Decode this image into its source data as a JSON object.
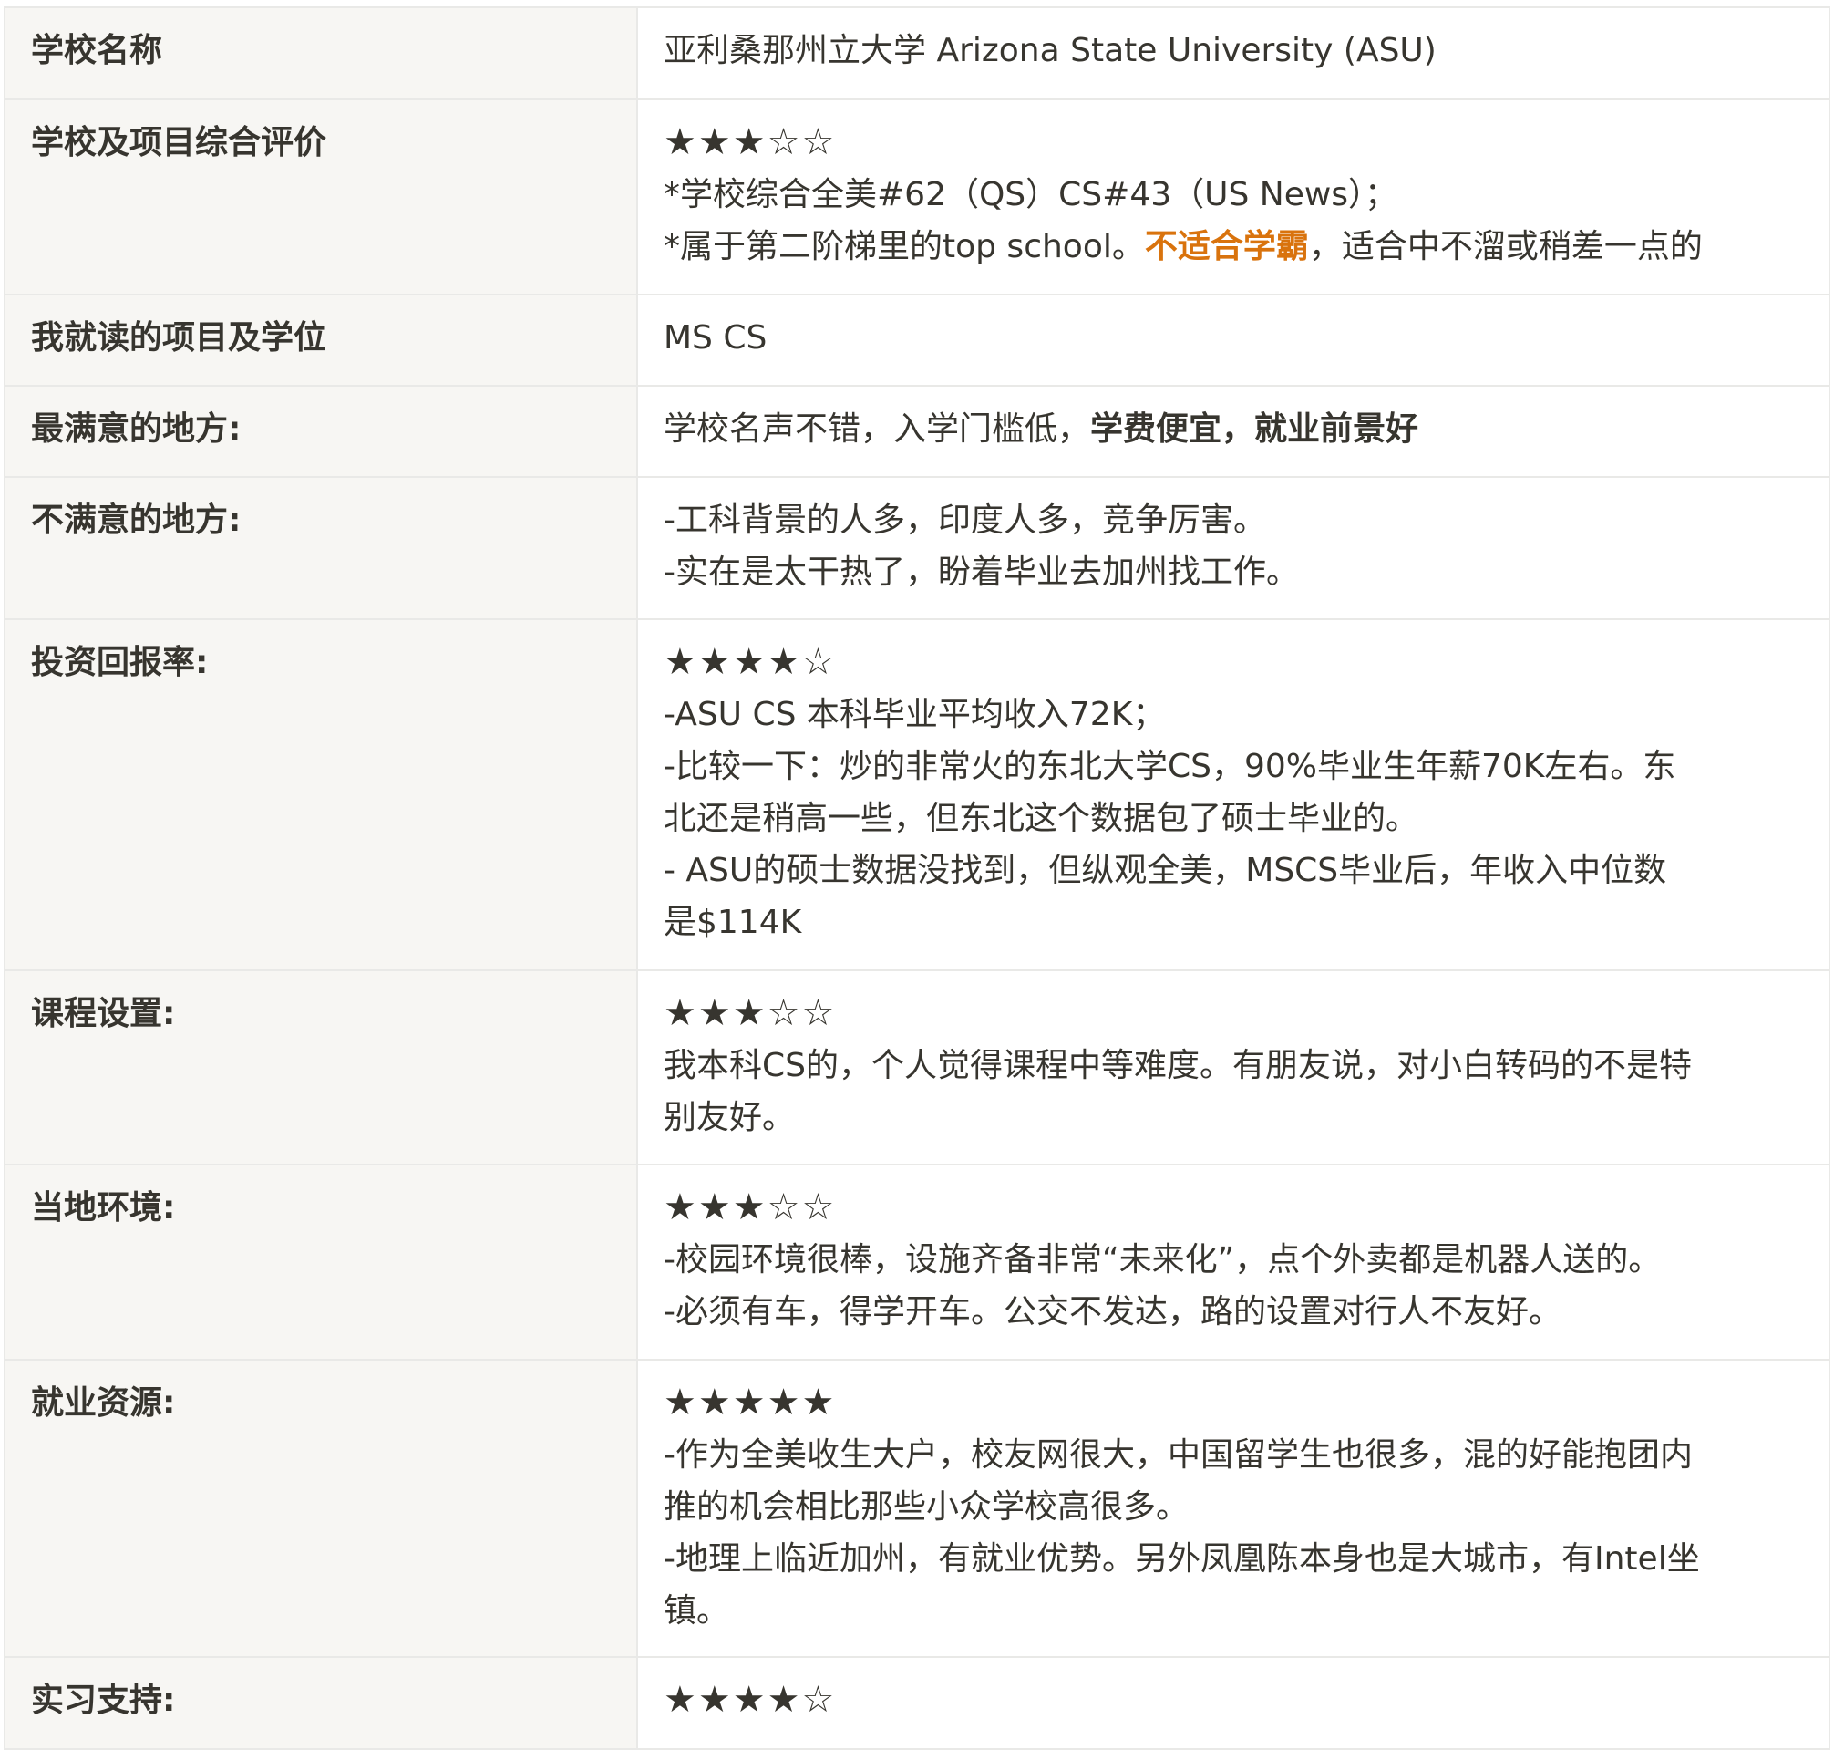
{
  "rows": [
    {
      "key": "学校名称",
      "lines": [
        "亚利桑那州立大学 Arizona State University (ASU)"
      ]
    },
    {
      "key": "学校及项目综合评价",
      "stars": "★★★☆☆",
      "stars_filled": 3,
      "lines": [
        "*学校综合全美#62（QS）CS#43（US News）；"
      ],
      "mixed": {
        "pre": "*属于第二阶梯里的top school。",
        "highlight": "不适合学霸",
        "post": "，适合中不溜或稍差一点的"
      },
      "highlight_color": "#d9730d"
    },
    {
      "key": "我就读的项目及学位",
      "lines": [
        "MS CS"
      ]
    },
    {
      "key": "最满意的地方:",
      "mixed": {
        "pre": "学校名声不错，入学门槛低，",
        "bold": "学费便宜，就业前景好"
      }
    },
    {
      "key": "不满意的地方:",
      "lines": [
        "-工科背景的人多，印度人多，竞争厉害。",
        "-实在是太干热了，盼着毕业去加州找工作。"
      ]
    },
    {
      "key": "投资回报率:",
      "stars": "★★★★☆",
      "stars_filled": 4,
      "lines": [
        "-ASU CS 本科毕业平均收入72K；",
        "-比较一下：炒的非常火的东北大学CS，90%毕业生年薪70K左右。东",
        "北还是稍高一些，但东北这个数据包了硕士毕业的。",
        "- ASU的硕士数据没找到，但纵观全美，MSCS毕业后，年收入中位数",
        "是$114K"
      ]
    },
    {
      "key": "课程设置:",
      "stars": "★★★☆☆",
      "stars_filled": 3,
      "lines": [
        "我本科CS的，个人觉得课程中等难度。有朋友说，对小白转码的不是特",
        "别友好。"
      ]
    },
    {
      "key": "当地环境:",
      "stars": "★★★☆☆",
      "stars_filled": 3,
      "lines": [
        "-校园环境很棒，设施齐备非常“未来化”，点个外卖都是机器人送的。",
        "-必须有车，得学开车。公交不发达，路的设置对行人不友好。"
      ]
    },
    {
      "key": "就业资源:",
      "stars": "★★★★★",
      "stars_filled": 5,
      "lines": [
        "-作为全美收生大户，校友网很大，中国留学生也很多，混的好能抱团内",
        "推的机会相比那些小众学校高很多。",
        "-地理上临近加州，有就业优势。另外凤凰陈本身也是大城市，有Intel坐",
        "镇。"
      ]
    },
    {
      "key": "实习支持:",
      "stars": "★★★★☆",
      "stars_filled": 4
    }
  ]
}
